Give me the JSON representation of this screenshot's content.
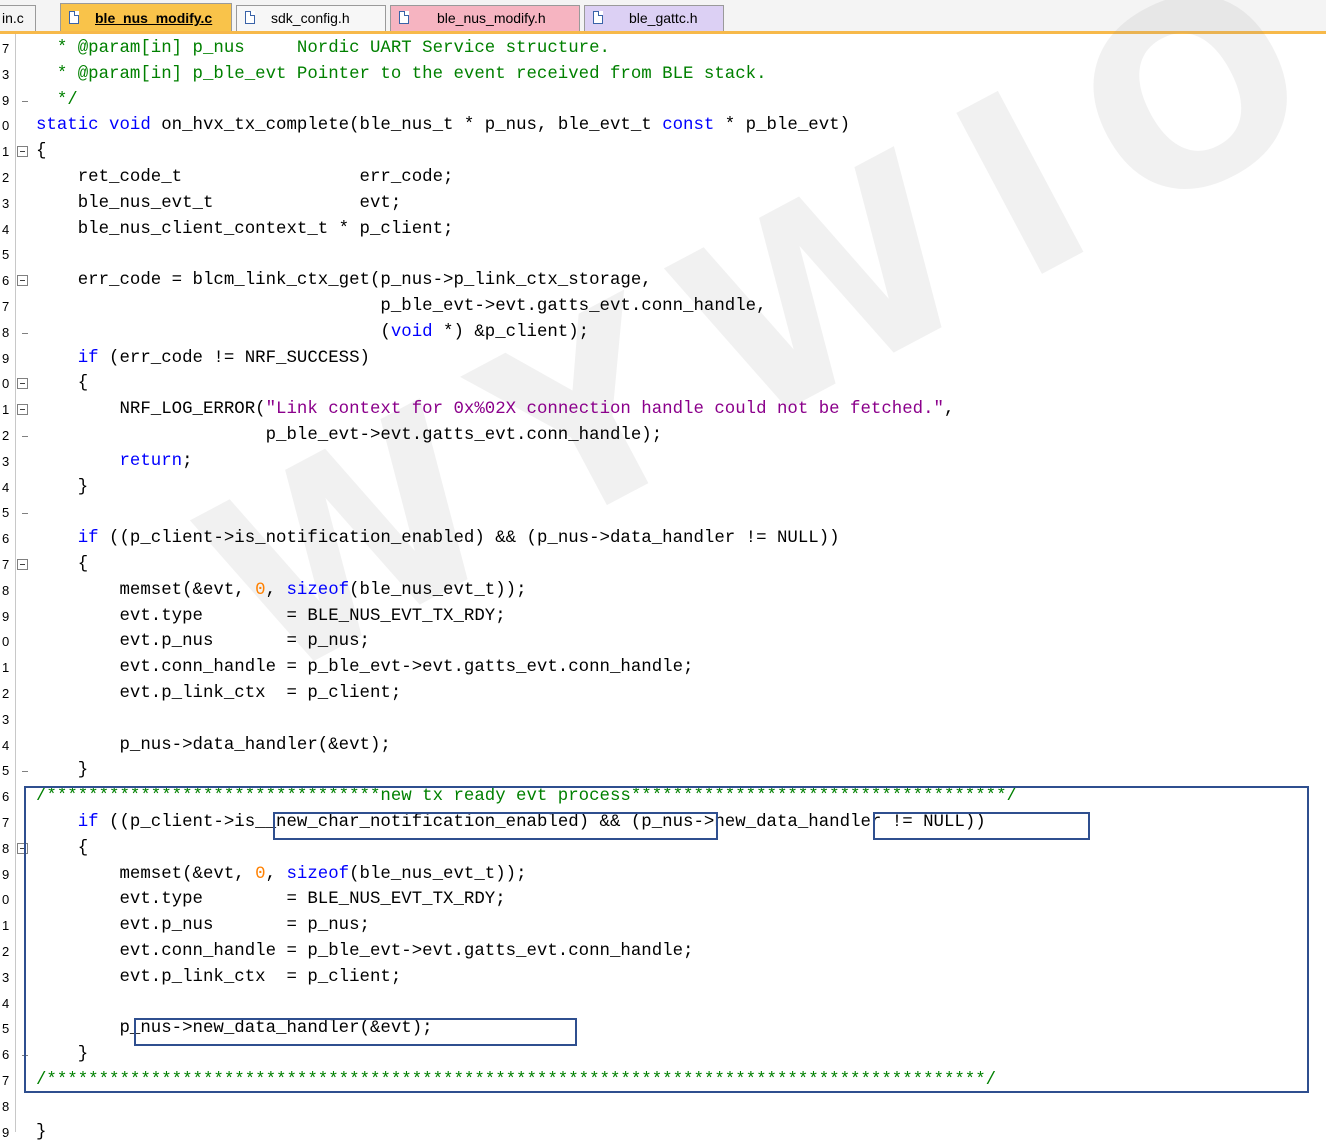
{
  "tabs": [
    {
      "label": "in.c",
      "active": false,
      "color": "#f4f4f4"
    },
    {
      "label": "ble_nus_modify.c",
      "active": true,
      "color": "#f9c34a"
    },
    {
      "label": "sdk_config.h",
      "active": false,
      "color": "#f7f7f7"
    },
    {
      "label": "ble_nus_modify.h",
      "active": false,
      "color": "#f6b4c1"
    },
    {
      "label": "ble_gattc.h",
      "active": false,
      "color": "#dcd0f4"
    }
  ],
  "gutter_numbers": [
    "7",
    "3",
    "9",
    "0",
    "1",
    "2",
    "3",
    "4",
    "5",
    "6",
    "7",
    "8",
    "9",
    "0",
    "1",
    "2",
    "3",
    "4",
    "5",
    "6",
    "7",
    "8",
    "9",
    "0",
    "1",
    "2",
    "3",
    "4",
    "5",
    "6",
    "7",
    "8",
    "9",
    "0",
    "1",
    "2",
    "3",
    "4",
    "5",
    "6",
    "7",
    "8",
    "9"
  ],
  "code_lines": [
    [
      [
        "cm",
        "  * @param[in] p_nus     Nordic UART Service structure."
      ]
    ],
    [
      [
        "cm",
        "  * @param[in] p_ble_evt Pointer to the event received from BLE stack."
      ]
    ],
    [
      [
        "cm",
        "  */"
      ]
    ],
    [
      [
        "kw",
        "static void"
      ],
      [
        "",
        " on_hvx_tx_complete(ble_nus_t * p_nus, ble_evt_t "
      ],
      [
        "kw",
        "const"
      ],
      [
        "",
        " * p_ble_evt)"
      ]
    ],
    [
      [
        "",
        "{"
      ]
    ],
    [
      [
        "",
        "    ret_code_t                 err_code;"
      ]
    ],
    [
      [
        "",
        "    ble_nus_evt_t              evt;"
      ]
    ],
    [
      [
        "",
        "    ble_nus_client_context_t * p_client;"
      ]
    ],
    [
      [
        "",
        ""
      ]
    ],
    [
      [
        "",
        "    err_code = blcm_link_ctx_get(p_nus->p_link_ctx_storage,"
      ]
    ],
    [
      [
        "",
        "                                 p_ble_evt->evt.gatts_evt.conn_handle,"
      ]
    ],
    [
      [
        "",
        "                                 ("
      ],
      [
        "kw",
        "void"
      ],
      [
        "",
        " *) &p_client);"
      ]
    ],
    [
      [
        "",
        "    "
      ],
      [
        "kw",
        "if"
      ],
      [
        "",
        " (err_code != NRF_SUCCESS)"
      ]
    ],
    [
      [
        "",
        "    {"
      ]
    ],
    [
      [
        "",
        "        NRF_LOG_ERROR("
      ],
      [
        "st",
        "\"Link context for 0x%02X connection handle could not be fetched.\""
      ],
      [
        "",
        ","
      ]
    ],
    [
      [
        "",
        "                      p_ble_evt->evt.gatts_evt.conn_handle);"
      ]
    ],
    [
      [
        "",
        "        "
      ],
      [
        "kw",
        "return"
      ],
      [
        "",
        ";"
      ]
    ],
    [
      [
        "",
        "    }"
      ]
    ],
    [
      [
        "",
        ""
      ]
    ],
    [
      [
        "",
        "    "
      ],
      [
        "kw",
        "if"
      ],
      [
        "",
        " ((p_client->is_notification_enabled) && (p_nus->data_handler != NULL))"
      ]
    ],
    [
      [
        "",
        "    {"
      ]
    ],
    [
      [
        "",
        "        memset(&evt, "
      ],
      [
        "nm",
        "0"
      ],
      [
        "",
        ", "
      ],
      [
        "kw",
        "sizeof"
      ],
      [
        "",
        "(ble_nus_evt_t));"
      ]
    ],
    [
      [
        "",
        "        evt.type        = BLE_NUS_EVT_TX_RDY;"
      ]
    ],
    [
      [
        "",
        "        evt.p_nus       = p_nus;"
      ]
    ],
    [
      [
        "",
        "        evt.conn_handle = p_ble_evt->evt.gatts_evt.conn_handle;"
      ]
    ],
    [
      [
        "",
        "        evt.p_link_ctx  = p_client;"
      ]
    ],
    [
      [
        "",
        ""
      ]
    ],
    [
      [
        "",
        "        p_nus->data_handler(&evt);"
      ]
    ],
    [
      [
        "",
        "    }"
      ]
    ],
    [
      [
        "cm",
        "/********************************new tx ready evt process************************************/"
      ]
    ],
    [
      [
        "",
        "    "
      ],
      [
        "kw",
        "if"
      ],
      [
        "",
        " ((p_client->is__new_char_notification_enabled) && (p_nus->new_data_handler != NULL))"
      ]
    ],
    [
      [
        "",
        "    {"
      ]
    ],
    [
      [
        "",
        "        memset(&evt, "
      ],
      [
        "nm",
        "0"
      ],
      [
        "",
        ", "
      ],
      [
        "kw",
        "sizeof"
      ],
      [
        "",
        "(ble_nus_evt_t));"
      ]
    ],
    [
      [
        "",
        "        evt.type        = BLE_NUS_EVT_TX_RDY;"
      ]
    ],
    [
      [
        "",
        "        evt.p_nus       = p_nus;"
      ]
    ],
    [
      [
        "",
        "        evt.conn_handle = p_ble_evt->evt.gatts_evt.conn_handle;"
      ]
    ],
    [
      [
        "",
        "        evt.p_link_ctx  = p_client;"
      ]
    ],
    [
      [
        "",
        ""
      ]
    ],
    [
      [
        "",
        "        p_nus->new_data_handler(&evt);"
      ]
    ],
    [
      [
        "",
        "    }"
      ]
    ],
    [
      [
        "cm",
        "/******************************************************************************************/"
      ]
    ],
    [
      [
        "",
        ""
      ]
    ],
    [
      [
        "",
        "}"
      ]
    ]
  ],
  "watermark": "WYWIOT",
  "colors": {
    "keyword": "#0000ff",
    "comment": "#008000",
    "string": "#8b008b",
    "number": "#ff8000",
    "active_tab": "#f9c34a",
    "highlight_box": "#2f4f8f"
  }
}
